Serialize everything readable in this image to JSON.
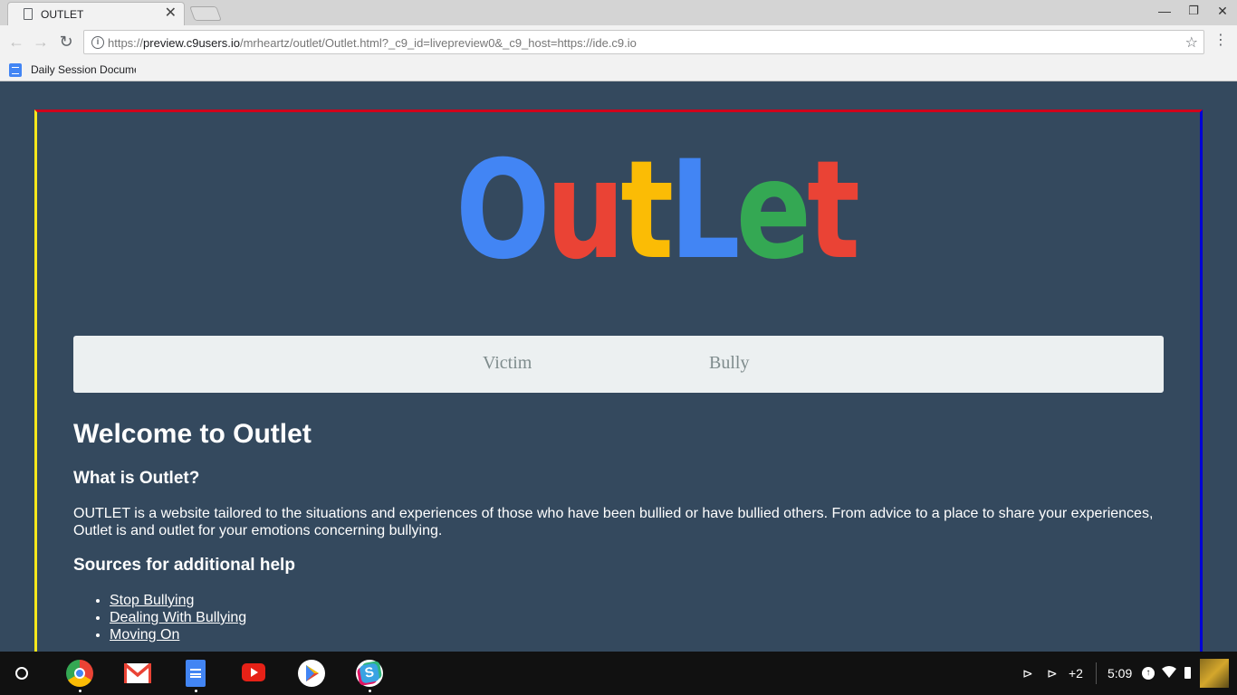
{
  "browser": {
    "tab_title": "OUTLET",
    "close_glyph": "✕",
    "url_scheme": "https://",
    "url_host": "preview.c9users.io",
    "url_path": "/mrheartz/outlet/Outlet.html?_c9_id=livepreview0&_c9_host=https://ide.c9.io",
    "bookmark_label": "Daily Session Document"
  },
  "page": {
    "logo": {
      "letters": [
        {
          "char": "O",
          "color": "#4285f4"
        },
        {
          "char": "u",
          "color": "#ea4335"
        },
        {
          "char": "t",
          "color": "#fbbc05"
        },
        {
          "char": "L",
          "color": "#4285f4"
        },
        {
          "char": "e",
          "color": "#34a853"
        },
        {
          "char": "t",
          "color": "#ea4335"
        }
      ]
    },
    "nav": {
      "victim": "Victim",
      "bully": "Bully"
    },
    "heading": "Welcome to Outlet",
    "subheading": "What is Outlet?",
    "description": "OUTLET is a website tailored to the situations and experiences of those who have been bullied or have bullied others. From advice to a place to share your experiences, Outlet is and outlet for your emotions concerning bullying.",
    "sources_heading": "Sources for additional help",
    "sources": [
      "Stop Bullying",
      "Dealing With Bullying",
      "Moving On"
    ]
  },
  "shelf": {
    "apps": [
      "chrome-icon",
      "gmail-icon",
      "docs-icon",
      "youtube-icon",
      "play-store-icon",
      "slack-icon"
    ],
    "notif_count": "+2",
    "time": "5:09"
  },
  "colors": {
    "page_bg": "#34495e",
    "frame_top": "#d0021b",
    "frame_left": "#f8e71c",
    "frame_right": "#0000d6",
    "navbar_bg": "#ecf0f1",
    "nav_text": "#7f8c8d"
  }
}
